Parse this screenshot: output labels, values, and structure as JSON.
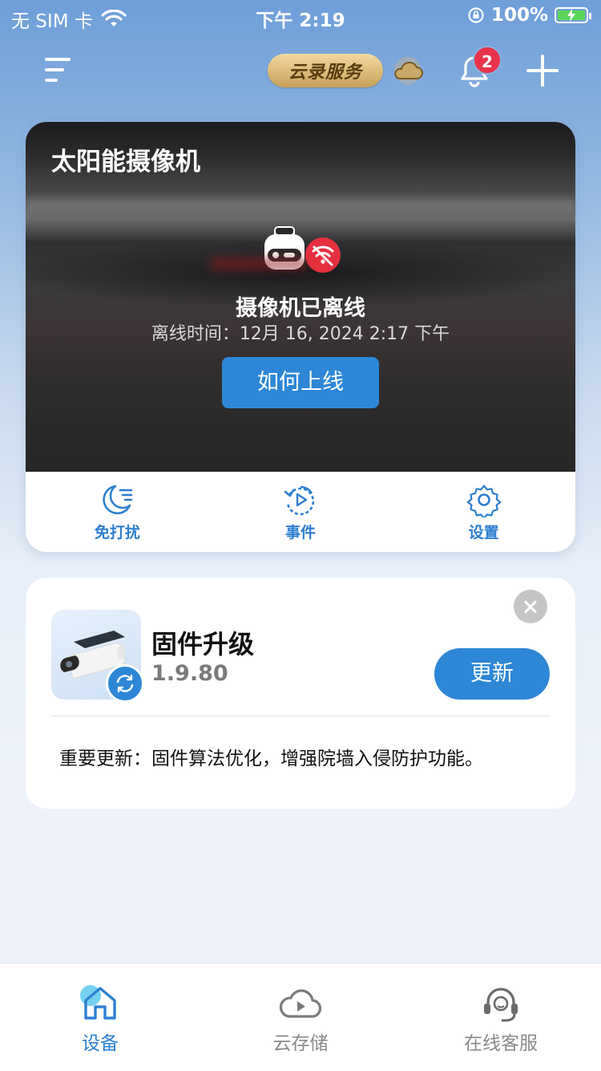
{
  "status_bar": {
    "carrier": "无 SIM 卡",
    "time": "下午 2:19",
    "battery": "100%",
    "icons": [
      "wifi-icon",
      "rotation-lock-icon",
      "battery-charging-icon"
    ]
  },
  "header": {
    "cloud_service_label": "云录服务",
    "notification_count": "2",
    "icons": [
      "menu-icon",
      "cloud-icon",
      "bell-icon",
      "plus-icon"
    ]
  },
  "camera_card": {
    "title": "太阳能摄像机",
    "status_title": "摄像机已离线",
    "offline_time": "离线时间：12月 16, 2024 2:17 下午",
    "online_button": "如何上线",
    "actions": [
      {
        "label": "免打扰",
        "icon": "moon-icon"
      },
      {
        "label": "事件",
        "icon": "play-circle-icon"
      },
      {
        "label": "设置",
        "icon": "gear-icon"
      }
    ]
  },
  "firmware_card": {
    "title": "固件升级",
    "version": "1.9.80",
    "update_button": "更新",
    "note": "重要更新：固件算法优化，增强院墙入侵防护功能。"
  },
  "tab_bar": {
    "tabs": [
      {
        "label": "设备",
        "icon": "home-icon",
        "active": true
      },
      {
        "label": "云存储",
        "icon": "cloud-play-icon",
        "active": false
      },
      {
        "label": "在线客服",
        "icon": "headset-icon",
        "active": false
      }
    ]
  },
  "colors": {
    "accent": "#2d87d6",
    "badge_red": "#e8334a",
    "offline_red": "#e6303f",
    "gold": "#d9b772"
  }
}
